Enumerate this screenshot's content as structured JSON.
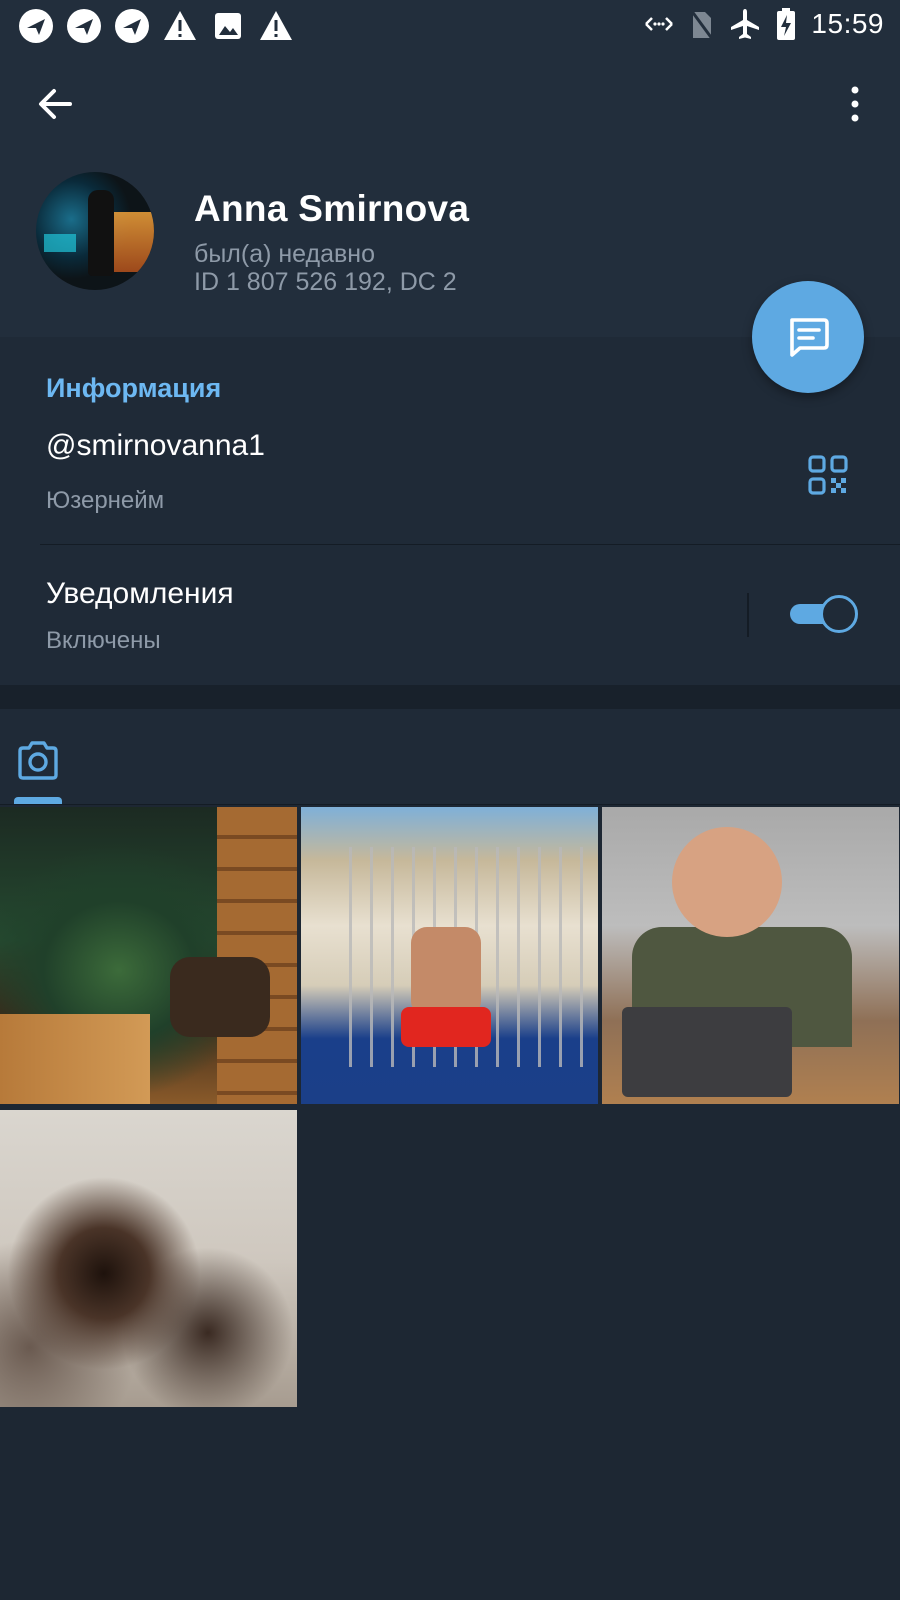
{
  "status_bar": {
    "time": "15:59",
    "left_icons": [
      "app-notification-icon",
      "app-notification-icon",
      "app-notification-icon",
      "warning-icon",
      "image-icon",
      "warning-icon"
    ],
    "right_icons": [
      "data-saver-icon",
      "no-sim-icon",
      "airplane-mode-icon",
      "battery-charging-icon"
    ]
  },
  "header": {
    "name": "Anna Smirnova",
    "last_seen": "был(а) недавно",
    "user_id": "ID 1 807 526 192, DC 2"
  },
  "info": {
    "section_title": "Информация",
    "username": "@smirnovanna1",
    "username_label": "Юзернейм",
    "notifications_title": "Уведомления",
    "notifications_status": "Включены",
    "notifications_on": true
  },
  "media": {
    "active_tab": "photos",
    "tiles": [
      "photo-sauna",
      "photo-pool",
      "photo-laptop",
      "photo-blurred"
    ]
  },
  "colors": {
    "background": "#1d2733",
    "header": "#222e3c",
    "accent": "#5ea9e2",
    "section_title": "#6db8f2",
    "secondary_text": "#8e9aa8"
  }
}
